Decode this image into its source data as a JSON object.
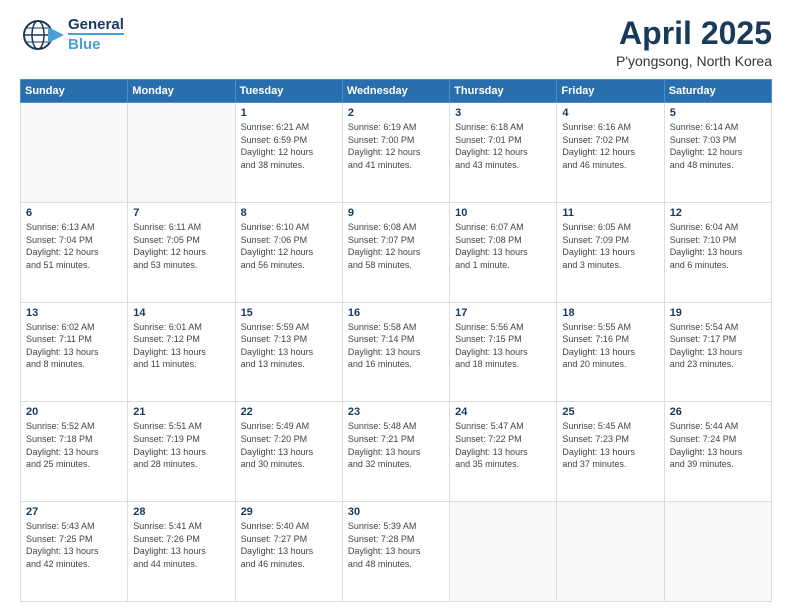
{
  "header": {
    "logo_line1": "General",
    "logo_line2": "Blue",
    "month": "April 2025",
    "location": "P'yongsong, North Korea"
  },
  "weekdays": [
    "Sunday",
    "Monday",
    "Tuesday",
    "Wednesday",
    "Thursday",
    "Friday",
    "Saturday"
  ],
  "weeks": [
    [
      {
        "day": "",
        "info": ""
      },
      {
        "day": "",
        "info": ""
      },
      {
        "day": "1",
        "info": "Sunrise: 6:21 AM\nSunset: 6:59 PM\nDaylight: 12 hours\nand 38 minutes."
      },
      {
        "day": "2",
        "info": "Sunrise: 6:19 AM\nSunset: 7:00 PM\nDaylight: 12 hours\nand 41 minutes."
      },
      {
        "day": "3",
        "info": "Sunrise: 6:18 AM\nSunset: 7:01 PM\nDaylight: 12 hours\nand 43 minutes."
      },
      {
        "day": "4",
        "info": "Sunrise: 6:16 AM\nSunset: 7:02 PM\nDaylight: 12 hours\nand 46 minutes."
      },
      {
        "day": "5",
        "info": "Sunrise: 6:14 AM\nSunset: 7:03 PM\nDaylight: 12 hours\nand 48 minutes."
      }
    ],
    [
      {
        "day": "6",
        "info": "Sunrise: 6:13 AM\nSunset: 7:04 PM\nDaylight: 12 hours\nand 51 minutes."
      },
      {
        "day": "7",
        "info": "Sunrise: 6:11 AM\nSunset: 7:05 PM\nDaylight: 12 hours\nand 53 minutes."
      },
      {
        "day": "8",
        "info": "Sunrise: 6:10 AM\nSunset: 7:06 PM\nDaylight: 12 hours\nand 56 minutes."
      },
      {
        "day": "9",
        "info": "Sunrise: 6:08 AM\nSunset: 7:07 PM\nDaylight: 12 hours\nand 58 minutes."
      },
      {
        "day": "10",
        "info": "Sunrise: 6:07 AM\nSunset: 7:08 PM\nDaylight: 13 hours\nand 1 minute."
      },
      {
        "day": "11",
        "info": "Sunrise: 6:05 AM\nSunset: 7:09 PM\nDaylight: 13 hours\nand 3 minutes."
      },
      {
        "day": "12",
        "info": "Sunrise: 6:04 AM\nSunset: 7:10 PM\nDaylight: 13 hours\nand 6 minutes."
      }
    ],
    [
      {
        "day": "13",
        "info": "Sunrise: 6:02 AM\nSunset: 7:11 PM\nDaylight: 13 hours\nand 8 minutes."
      },
      {
        "day": "14",
        "info": "Sunrise: 6:01 AM\nSunset: 7:12 PM\nDaylight: 13 hours\nand 11 minutes."
      },
      {
        "day": "15",
        "info": "Sunrise: 5:59 AM\nSunset: 7:13 PM\nDaylight: 13 hours\nand 13 minutes."
      },
      {
        "day": "16",
        "info": "Sunrise: 5:58 AM\nSunset: 7:14 PM\nDaylight: 13 hours\nand 16 minutes."
      },
      {
        "day": "17",
        "info": "Sunrise: 5:56 AM\nSunset: 7:15 PM\nDaylight: 13 hours\nand 18 minutes."
      },
      {
        "day": "18",
        "info": "Sunrise: 5:55 AM\nSunset: 7:16 PM\nDaylight: 13 hours\nand 20 minutes."
      },
      {
        "day": "19",
        "info": "Sunrise: 5:54 AM\nSunset: 7:17 PM\nDaylight: 13 hours\nand 23 minutes."
      }
    ],
    [
      {
        "day": "20",
        "info": "Sunrise: 5:52 AM\nSunset: 7:18 PM\nDaylight: 13 hours\nand 25 minutes."
      },
      {
        "day": "21",
        "info": "Sunrise: 5:51 AM\nSunset: 7:19 PM\nDaylight: 13 hours\nand 28 minutes."
      },
      {
        "day": "22",
        "info": "Sunrise: 5:49 AM\nSunset: 7:20 PM\nDaylight: 13 hours\nand 30 minutes."
      },
      {
        "day": "23",
        "info": "Sunrise: 5:48 AM\nSunset: 7:21 PM\nDaylight: 13 hours\nand 32 minutes."
      },
      {
        "day": "24",
        "info": "Sunrise: 5:47 AM\nSunset: 7:22 PM\nDaylight: 13 hours\nand 35 minutes."
      },
      {
        "day": "25",
        "info": "Sunrise: 5:45 AM\nSunset: 7:23 PM\nDaylight: 13 hours\nand 37 minutes."
      },
      {
        "day": "26",
        "info": "Sunrise: 5:44 AM\nSunset: 7:24 PM\nDaylight: 13 hours\nand 39 minutes."
      }
    ],
    [
      {
        "day": "27",
        "info": "Sunrise: 5:43 AM\nSunset: 7:25 PM\nDaylight: 13 hours\nand 42 minutes."
      },
      {
        "day": "28",
        "info": "Sunrise: 5:41 AM\nSunset: 7:26 PM\nDaylight: 13 hours\nand 44 minutes."
      },
      {
        "day": "29",
        "info": "Sunrise: 5:40 AM\nSunset: 7:27 PM\nDaylight: 13 hours\nand 46 minutes."
      },
      {
        "day": "30",
        "info": "Sunrise: 5:39 AM\nSunset: 7:28 PM\nDaylight: 13 hours\nand 48 minutes."
      },
      {
        "day": "",
        "info": ""
      },
      {
        "day": "",
        "info": ""
      },
      {
        "day": "",
        "info": ""
      }
    ]
  ]
}
